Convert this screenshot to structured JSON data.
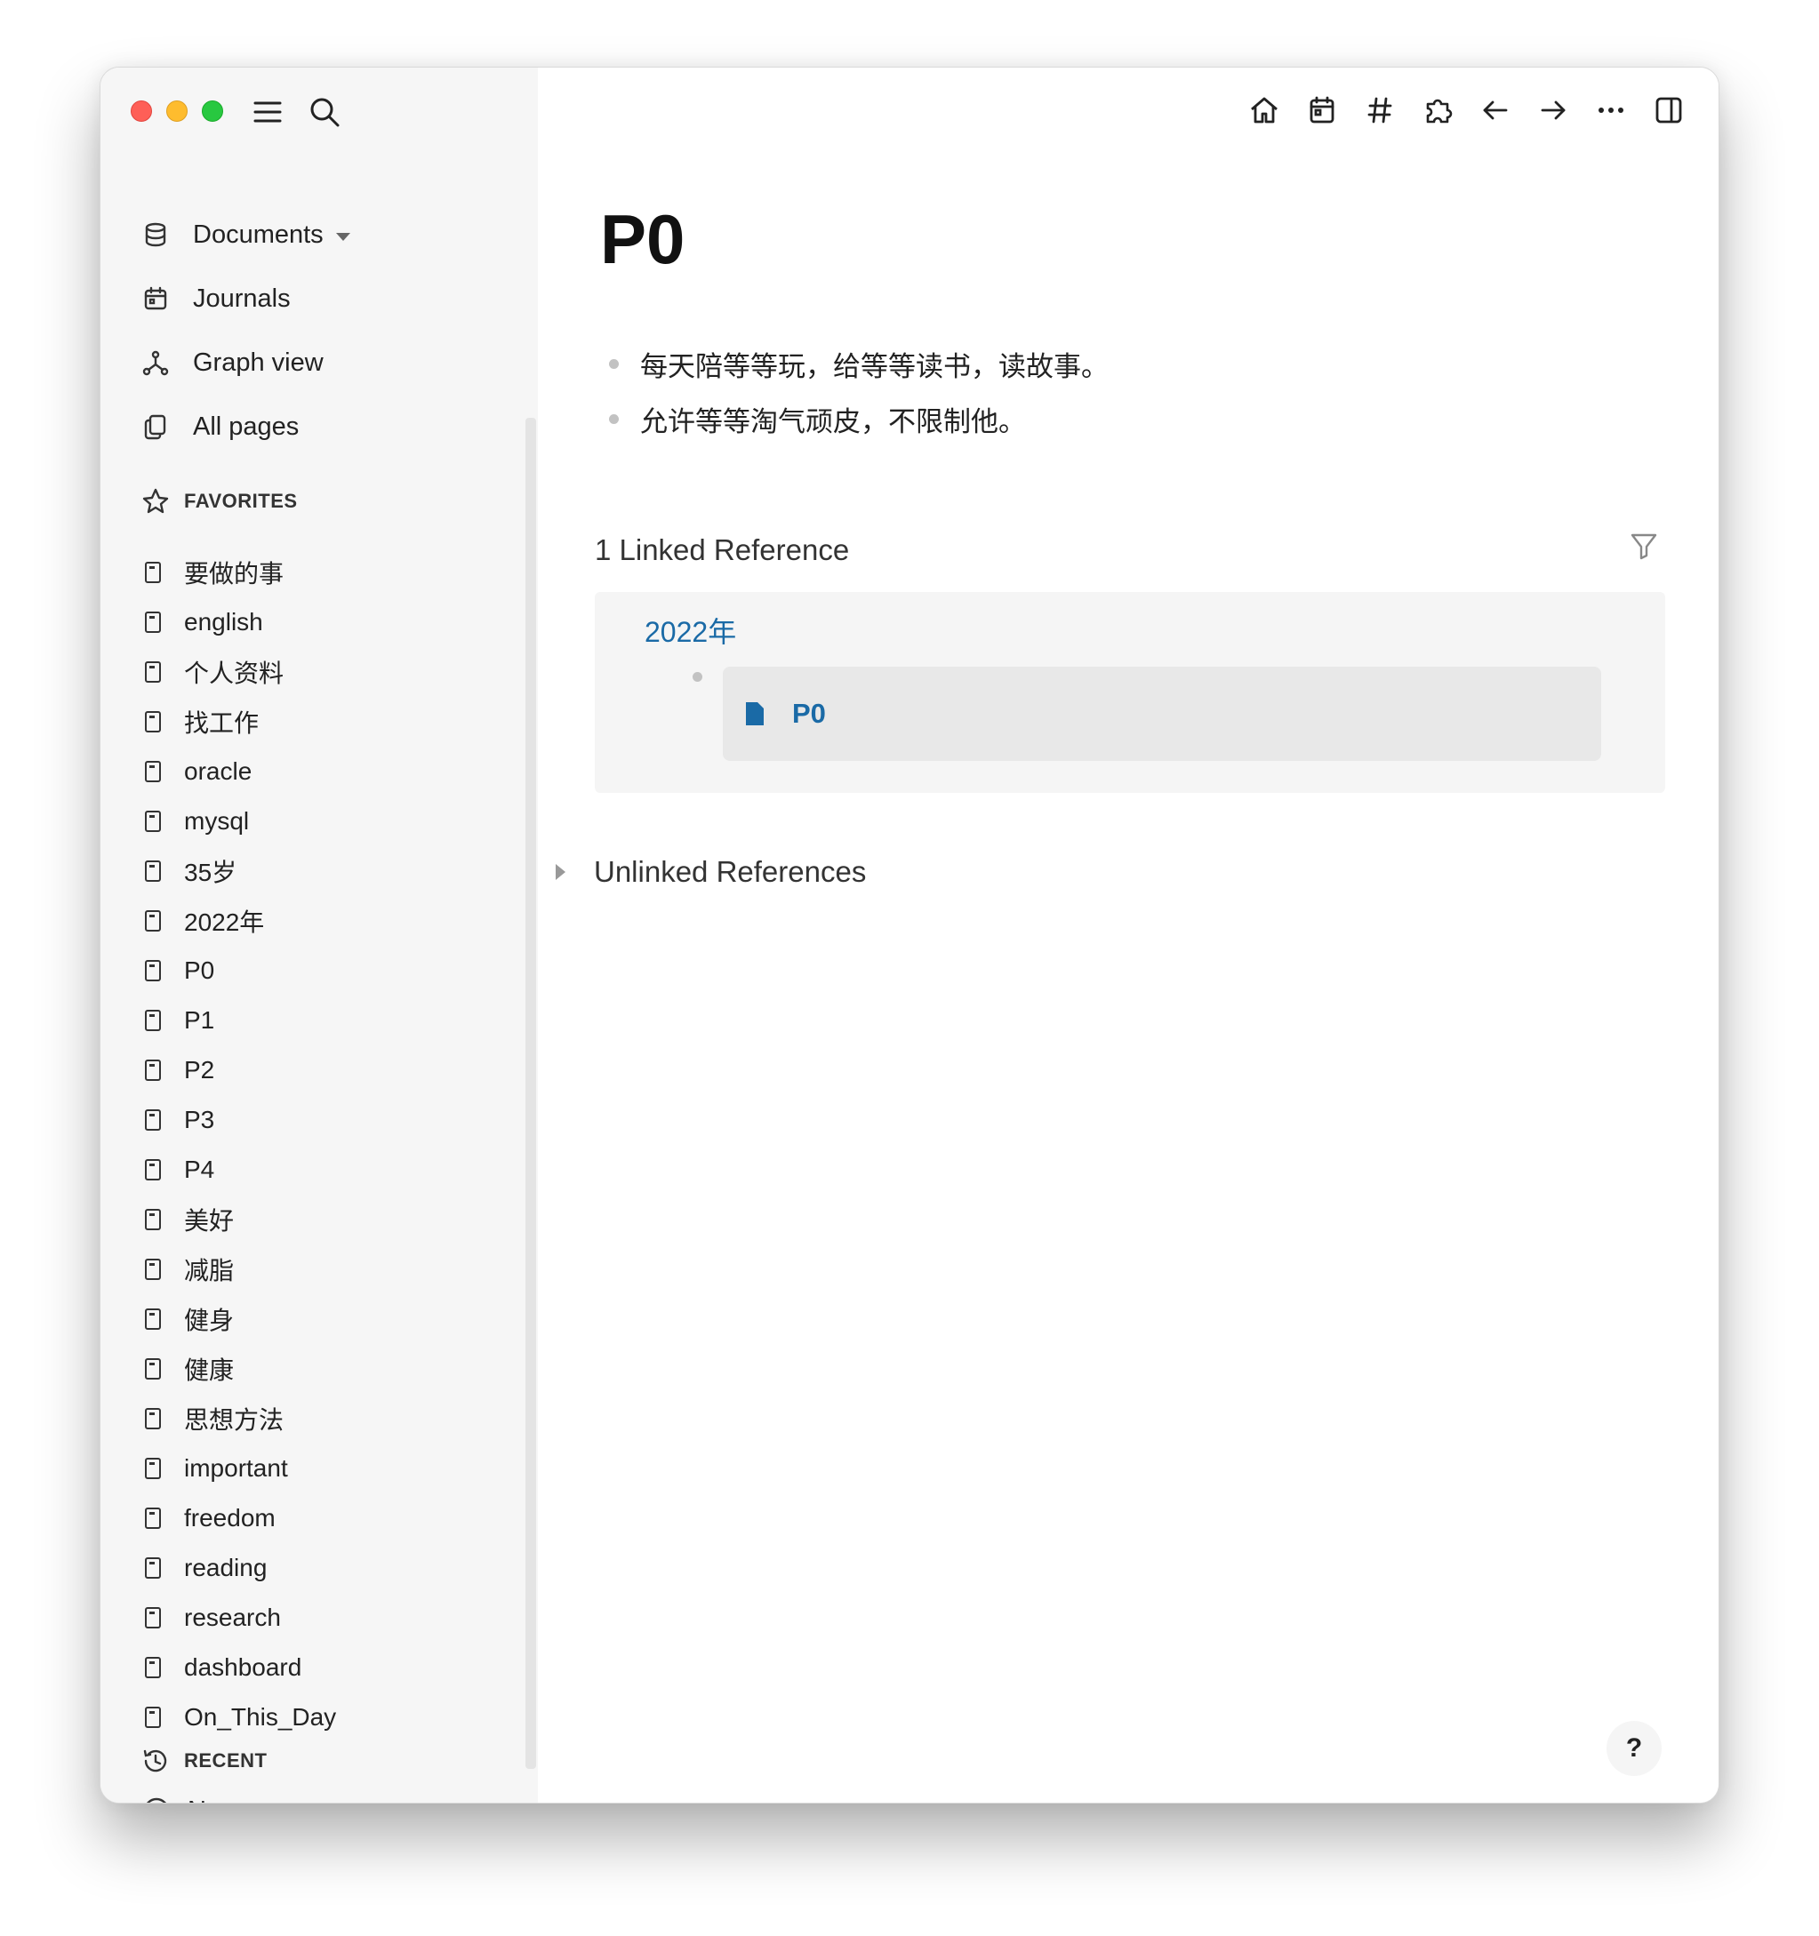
{
  "sidebar": {
    "nav": [
      {
        "label": "Documents",
        "icon": "database-icon",
        "has_caret": true
      },
      {
        "label": "Journals",
        "icon": "calendar-icon"
      },
      {
        "label": "Graph view",
        "icon": "graph-icon"
      },
      {
        "label": "All pages",
        "icon": "pages-icon"
      }
    ],
    "favorites_title": "FAVORITES",
    "favorites": [
      "要做的事",
      "english",
      "个人资料",
      "找工作",
      "oracle",
      "mysql",
      "35岁",
      "2022年",
      "P0",
      "P1",
      "P2",
      "P3",
      "P4",
      "美好",
      "减脂",
      "健身",
      "健康",
      "思想方法",
      "important",
      "freedom",
      "reading",
      "research",
      "dashboard",
      "On_This_Day"
    ],
    "recent_title": "RECENT",
    "new_page_label": "New page"
  },
  "page": {
    "title": "P0",
    "blocks": [
      "每天陪等等玩，给等等读书，读故事。",
      "允许等等淘气顽皮，不限制他。"
    ],
    "linked_refs_title": "1 Linked Reference",
    "linked_ref_group": "2022年",
    "linked_ref_block": "P0",
    "unlinked_refs_title": "Unlinked References"
  },
  "help_label": "?",
  "colors": {
    "link": "#1a6aa6",
    "sidebar_bg": "#f6f6f6",
    "ref_bg": "#f5f5f5",
    "ref_block_bg": "#e8e8e8"
  }
}
